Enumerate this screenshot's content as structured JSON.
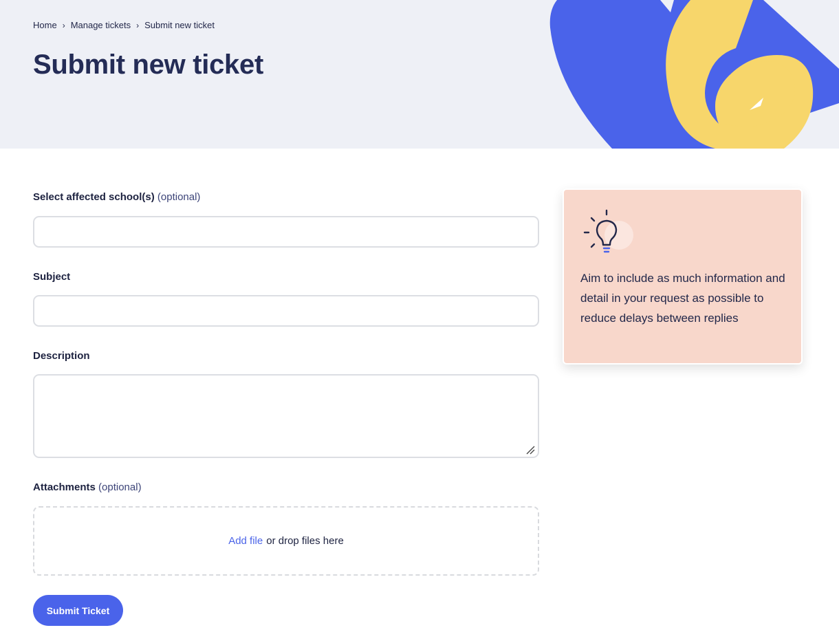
{
  "breadcrumb": {
    "items": [
      "Home",
      "Manage tickets",
      "Submit new ticket"
    ],
    "separator": "›"
  },
  "page": {
    "title": "Submit new ticket"
  },
  "form": {
    "schools_label": "Select affected school(s)",
    "schools_optional": "(optional)",
    "schools_value": "",
    "subject_label": "Subject",
    "subject_value": "",
    "description_label": "Description",
    "description_value": "",
    "attachments_label": "Attachments",
    "attachments_optional": "(optional)",
    "add_file_link": "Add file",
    "drop_text": "or drop files here",
    "submit_label": "Submit Ticket"
  },
  "tip": {
    "icon": "lightbulb-icon",
    "text": "Aim to include as much information and detail in your request as possible to reduce delays between replies"
  },
  "colors": {
    "primary": "#4a63ea",
    "hero_background": "#eef0f6",
    "hero_yellow": "#f7d66b",
    "tip_background": "#f8d7cb",
    "heading": "#242c56"
  }
}
